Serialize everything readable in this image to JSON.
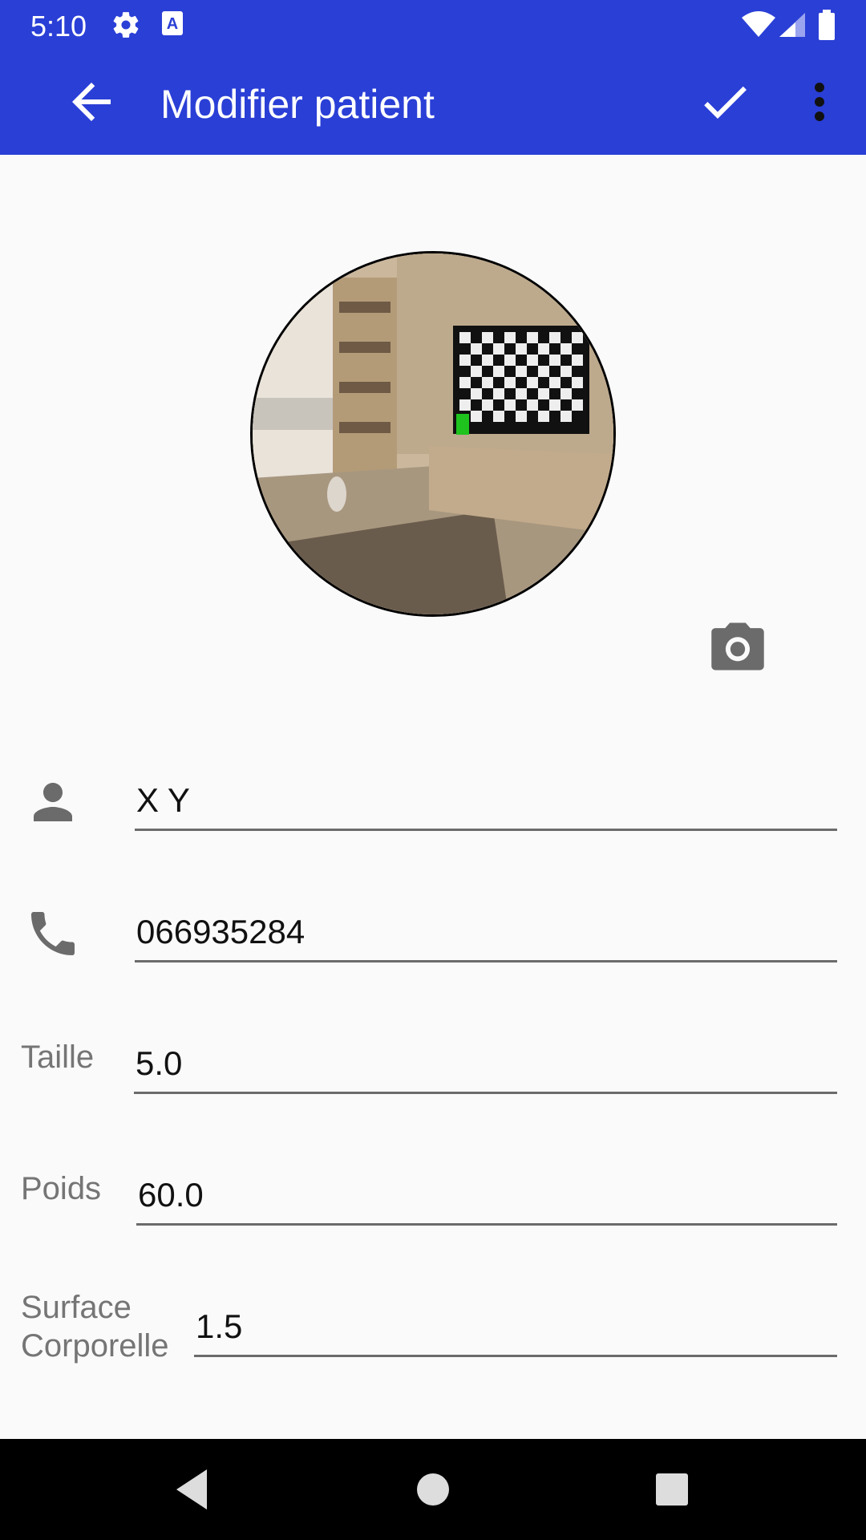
{
  "status_bar": {
    "time": "5:10",
    "left_icons": [
      "gear-icon",
      "a-icon"
    ],
    "right_icons": [
      "wifi-icon",
      "signal-icon",
      "battery-icon"
    ]
  },
  "app_bar": {
    "title": "Modifier patient",
    "back_icon": "arrow-left-icon",
    "confirm_icon": "check-icon",
    "menu_icon": "more-vert-icon",
    "background": "#2a3fd6"
  },
  "profile": {
    "photo": "room-with-tv-and-bookshelf",
    "camera_icon": "camera-icon"
  },
  "fields": {
    "name": {
      "icon": "person-icon",
      "value": "X Y"
    },
    "phone": {
      "icon": "phone-icon",
      "value": "066935284"
    },
    "height": {
      "label": "Taille",
      "value": "5.0"
    },
    "weight": {
      "label": "Poids",
      "value": "60.0"
    },
    "body_surface": {
      "label_line1": "Surface",
      "label_line2": "Corporelle",
      "value": "1.5"
    }
  },
  "nav_bar": {
    "icons": [
      "back-triangle-icon",
      "home-circle-icon",
      "recents-square-icon"
    ]
  }
}
